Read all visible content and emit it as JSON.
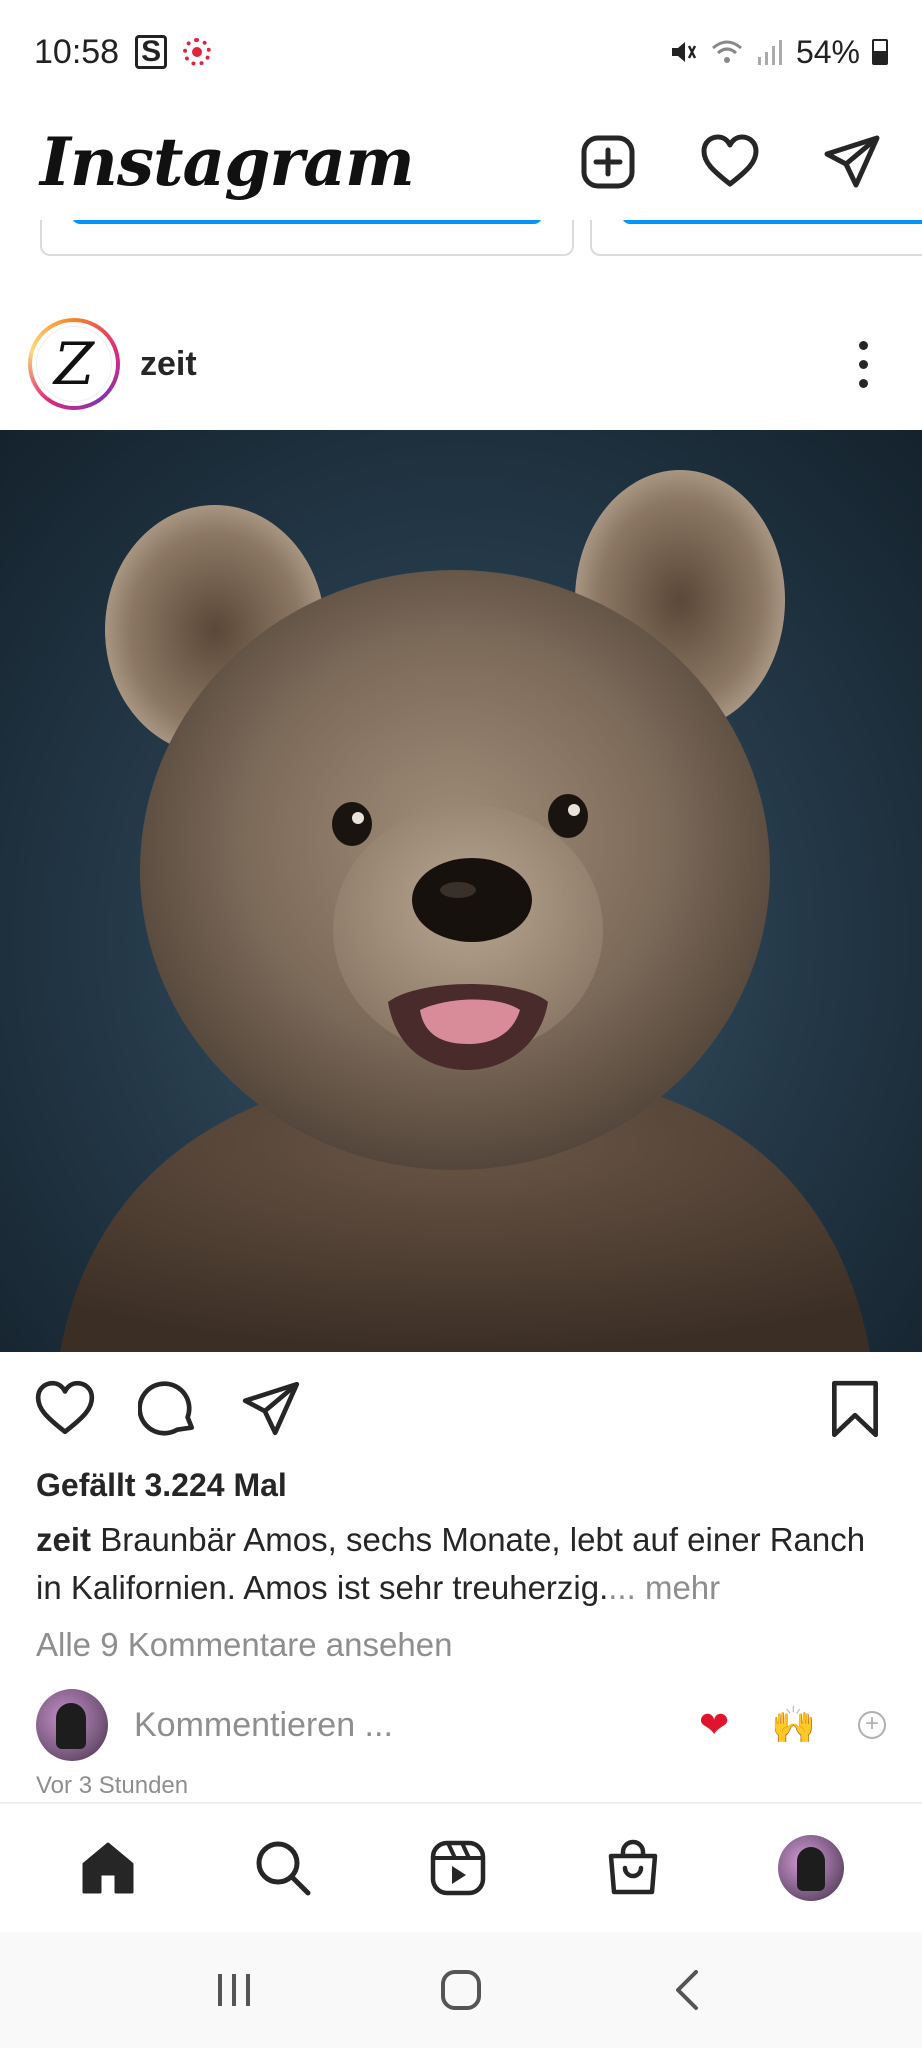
{
  "status_bar": {
    "time": "10:58",
    "s_icon_label": "S",
    "battery": "54%"
  },
  "header": {
    "logo": "Instagram"
  },
  "post": {
    "username": "zeit",
    "avatar_letter": "Z",
    "likes": "Gefällt 3.224 Mal",
    "caption_user": "zeit",
    "caption_text": "Braunbär Amos, sechs Monate, lebt auf einer Ranch in Kalifornien. Amos ist sehr treuherzig.",
    "caption_ellipsis": "...",
    "caption_more": " mehr",
    "view_comments": "Alle 9 Kommentare ansehen",
    "comment_placeholder": "Kommentieren ...",
    "reaction_heart": "❤",
    "reaction_hands": "🙌",
    "time_ago": "Vor 3 Stunden",
    "image_subject": "brown-bear-cub-photo"
  },
  "colors": {
    "accent_blue": "#0095f6",
    "text": "#262626",
    "muted": "#8e8e8e",
    "like_red": "#e0142c"
  },
  "icons": {
    "status": [
      "s-app-icon",
      "recording-dot-icon",
      "mute-icon",
      "wifi-icon",
      "signal-icon",
      "battery-icon"
    ],
    "top_nav": [
      "new-post-icon",
      "heart-icon",
      "direct-message-icon"
    ],
    "actions": [
      "like-icon",
      "comment-icon",
      "share-icon",
      "bookmark-icon"
    ],
    "bottom_nav": [
      "home-icon",
      "search-icon",
      "reels-icon",
      "shop-icon",
      "profile-avatar"
    ],
    "system_nav": [
      "recent-apps-icon",
      "home-button-icon",
      "back-icon"
    ]
  }
}
